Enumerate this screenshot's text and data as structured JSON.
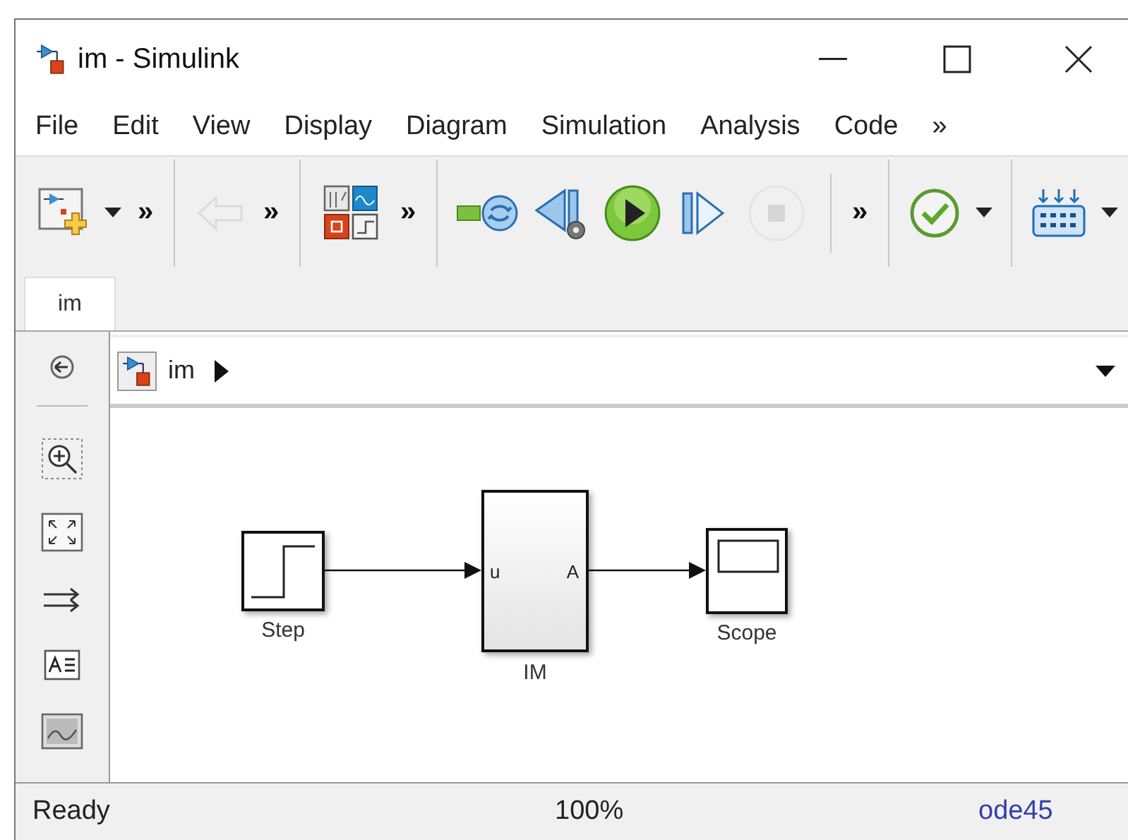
{
  "window": {
    "title": "im - Simulink"
  },
  "menu": [
    {
      "label": "File"
    },
    {
      "label": "Edit"
    },
    {
      "label": "View"
    },
    {
      "label": "Display"
    },
    {
      "label": "Diagram"
    },
    {
      "label": "Simulation"
    },
    {
      "label": "Analysis"
    },
    {
      "label": "Code"
    },
    {
      "label": "»"
    }
  ],
  "toolbar": {
    "items": [
      {
        "kind": "button",
        "disabled": false
      },
      {
        "kind": "caret"
      },
      {
        "kind": "more",
        "text": "»"
      },
      {
        "kind": "separator"
      },
      {
        "kind": "button",
        "disabled": true
      },
      {
        "kind": "more",
        "text": "»"
      },
      {
        "kind": "separator"
      },
      {
        "kind": "button",
        "disabled": false
      },
      {
        "kind": "more",
        "text": "»"
      },
      {
        "kind": "separator"
      },
      {
        "kind": "button",
        "disabled": false
      },
      {
        "kind": "button",
        "disabled": false
      },
      {
        "kind": "button",
        "disabled": false
      },
      {
        "kind": "button",
        "disabled": false
      },
      {
        "kind": "button",
        "disabled": true
      },
      {
        "kind": "separator"
      },
      {
        "kind": "more",
        "text": "»"
      },
      {
        "kind": "separator"
      },
      {
        "kind": "button",
        "disabled": false
      },
      {
        "kind": "caret"
      },
      {
        "kind": "separator"
      },
      {
        "kind": "button",
        "disabled": false
      },
      {
        "kind": "caret"
      }
    ]
  },
  "tabs": [
    {
      "label": "im",
      "selected": true
    }
  ],
  "breadcrumb": {
    "path": "im"
  },
  "diagram": {
    "blocks": [
      {
        "kind": "step",
        "label": "Step"
      },
      {
        "kind": "subsystem",
        "label": "IM",
        "inport": "u",
        "outport": "A"
      },
      {
        "kind": "scope",
        "label": "Scope"
      }
    ]
  },
  "status_bar": {
    "state": "Ready",
    "zoom": "100%",
    "solver": "ode45"
  }
}
